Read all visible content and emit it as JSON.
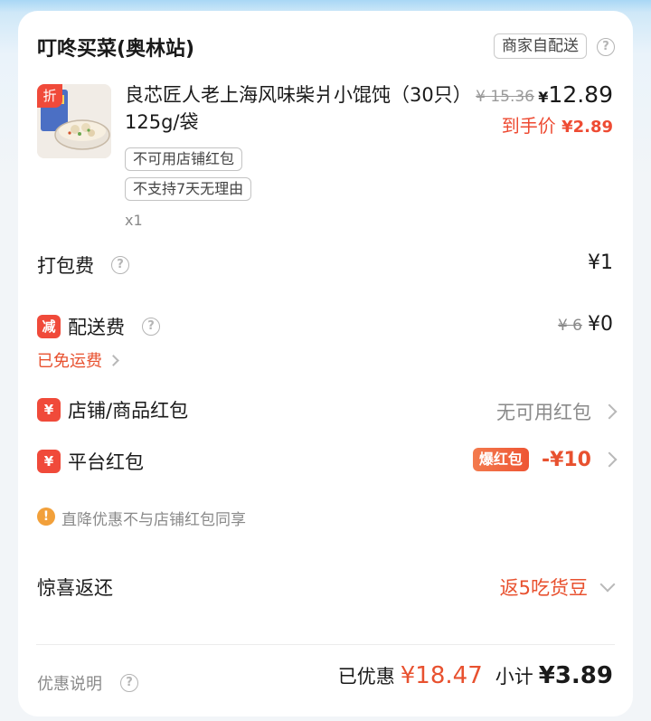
{
  "shop": {
    "name": "叮咚买菜(奥林站)",
    "delivery_tag": "商家自配送"
  },
  "product": {
    "badge": "折",
    "title": "良芯匠人老上海风味柴爿小馄饨（30只）125g/袋",
    "original_price": "¥ 15.36",
    "currency": "¥",
    "price": "12.89",
    "final_label": "到手价",
    "final_price": "¥2.89",
    "tags": [
      "不可用店铺红包",
      "不支持7天无理由"
    ],
    "quantity": "x1"
  },
  "packing_fee": {
    "label": "打包费",
    "value": "¥1"
  },
  "delivery_fee": {
    "badge": "减",
    "label": "配送费",
    "original": "¥ 6",
    "value": "¥0",
    "note": "已免运费"
  },
  "shop_coupon": {
    "badge": "¥",
    "label": "店铺/商品红包",
    "value": "无可用红包"
  },
  "platform_coupon": {
    "badge": "¥",
    "label": "平台红包",
    "hot_tag": "爆红包",
    "value": "-¥10"
  },
  "notice": {
    "icon": "!",
    "text": "直降优惠不与店铺红包同享"
  },
  "surprise": {
    "label": "惊喜返还",
    "value": "返5吃货豆"
  },
  "footer": {
    "discount_note": "优惠说明",
    "saved_label": "已优惠",
    "saved_value": "¥18.47",
    "subtotal_label": "小计",
    "subtotal_value": "¥3.89"
  },
  "colors": {
    "accent_red": "#f04a3a",
    "accent_orange": "#e8512f",
    "notice_orange": "#f2a03a"
  }
}
